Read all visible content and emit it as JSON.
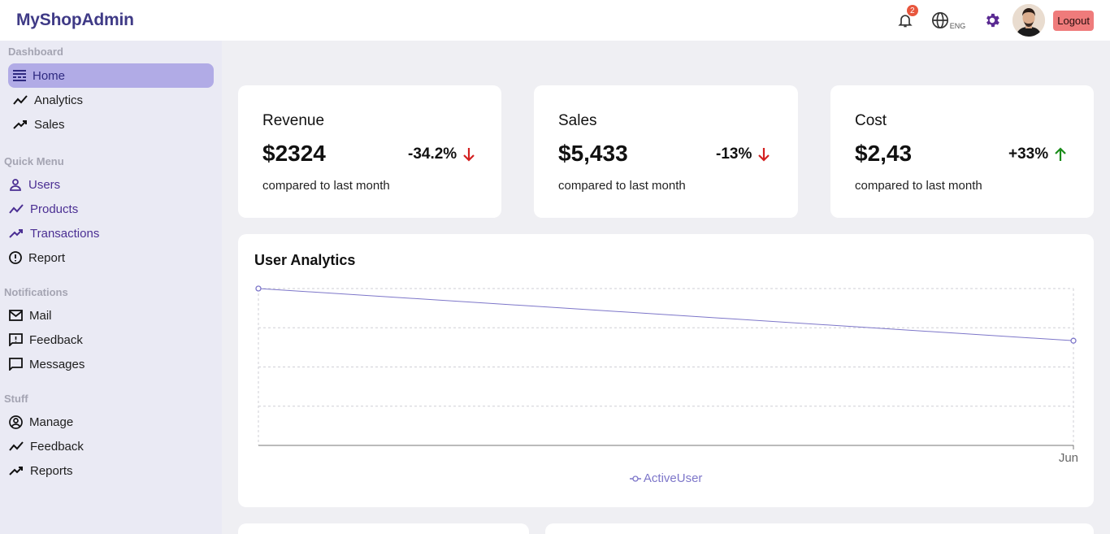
{
  "app": {
    "title": "MyShopAdmin"
  },
  "topbar": {
    "notification_count": "2",
    "language": "ENG",
    "logout_label": "Logout",
    "icons": [
      "bell-icon",
      "globe-icon",
      "gear-icon"
    ]
  },
  "sidebar": {
    "sections": [
      {
        "title": "Dashboard",
        "items": [
          {
            "label": "Home",
            "icon": "home-icon",
            "active": true
          },
          {
            "label": "Analytics",
            "icon": "trending-icon"
          },
          {
            "label": "Sales",
            "icon": "trending-up-icon"
          }
        ]
      },
      {
        "title": "Quick Menu",
        "items": [
          {
            "label": "Users",
            "icon": "user-icon"
          },
          {
            "label": "Products",
            "icon": "trending-icon"
          },
          {
            "label": "Transactions",
            "icon": "trending-up-icon"
          },
          {
            "label": "Report",
            "icon": "alert-icon"
          }
        ]
      },
      {
        "title": "Notifications",
        "items": [
          {
            "label": "Mail",
            "icon": "mail-icon"
          },
          {
            "label": "Feedback",
            "icon": "feedback-icon"
          },
          {
            "label": "Messages",
            "icon": "chat-icon"
          }
        ]
      },
      {
        "title": "Stuff",
        "items": [
          {
            "label": "Manage",
            "icon": "account-circle-icon"
          },
          {
            "label": "Feedback",
            "icon": "trending-icon"
          },
          {
            "label": "Reports",
            "icon": "trending-up-icon"
          }
        ]
      }
    ]
  },
  "stats": [
    {
      "title": "Revenue",
      "value": "$2324",
      "rate": "-34.2%",
      "direction": "down",
      "subtitle": "compared to last month"
    },
    {
      "title": "Sales",
      "value": "$5,433",
      "rate": "-13%",
      "direction": "down",
      "subtitle": "compared to last month"
    },
    {
      "title": "Cost",
      "value": "$2,43",
      "rate": "+33%",
      "direction": "up",
      "subtitle": "compared to last month"
    }
  ],
  "colors": {
    "accent": "#7d76c9",
    "down": "#d32020",
    "up": "#1a8c1a",
    "logout": "#ef7b7b"
  },
  "chart_data": {
    "type": "line",
    "title": "User Analytics",
    "x_tick_labels": [
      "Jun"
    ],
    "series": [
      {
        "name": "ActiveUser",
        "values": [
          4,
          2.67
        ]
      }
    ],
    "ylim": [
      0,
      4
    ],
    "grid": true,
    "legend_position": "bottom-center"
  }
}
